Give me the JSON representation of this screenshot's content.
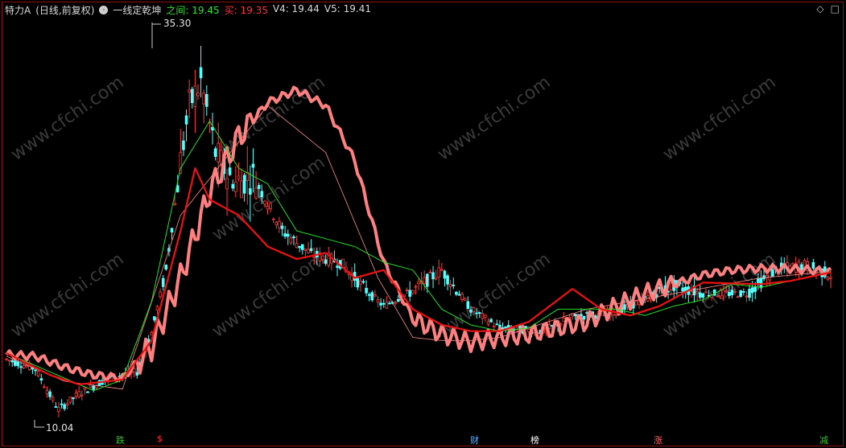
{
  "header": {
    "stock": "特力A",
    "mode": "(日线,前复权)",
    "indicator": "一线定乾坤",
    "items": [
      {
        "label": "之间:",
        "value": "19.45",
        "color": "#33dd33"
      },
      {
        "label": "买:",
        "value": "19.35",
        "color": "#ff3333"
      },
      {
        "label": "V4:",
        "value": "19.44",
        "color": "#d8d8d8"
      },
      {
        "label": "V5:",
        "value": "19.41",
        "color": "#d8d8d8"
      }
    ],
    "corner_icons": [
      "diamond-icon",
      "square-icon"
    ]
  },
  "annotations": {
    "high": "35.30",
    "low": "10.04"
  },
  "badges": [
    {
      "text": "跌",
      "color": "#22cc22"
    },
    {
      "text": "$",
      "color": "#ff2a2a"
    },
    {
      "text": "财",
      "color": "#5ab0ff"
    },
    {
      "text": "榜",
      "color": "#ffffff"
    },
    {
      "text": "涨",
      "color": "#ff6666"
    },
    {
      "text": "减",
      "color": "#22cc22"
    }
  ],
  "watermark": "www.cfchi.com",
  "chart_data": {
    "type": "candlestick",
    "ylim": [
      10.04,
      35.3
    ],
    "grid": false,
    "colors": {
      "up": "#ff3a3a",
      "down": "#54ffff",
      "ma_green": "#22dd22",
      "ma_red": "#ee1111",
      "band": "#ff8080",
      "thin": "#ff8c8c"
    },
    "series_keypoints": {
      "ma_green": [
        [
          0,
          14.2
        ],
        [
          20,
          12.6
        ],
        [
          30,
          11.8
        ],
        [
          40,
          12.5
        ],
        [
          50,
          17.5
        ],
        [
          60,
          26
        ],
        [
          70,
          29
        ],
        [
          80,
          26
        ],
        [
          90,
          25
        ],
        [
          100,
          22
        ],
        [
          110,
          21.5
        ],
        [
          120,
          21
        ],
        [
          130,
          20
        ],
        [
          140,
          19.5
        ],
        [
          150,
          17
        ],
        [
          160,
          16
        ],
        [
          170,
          15.6
        ],
        [
          180,
          15.8
        ],
        [
          190,
          17
        ],
        [
          200,
          17
        ],
        [
          210,
          17
        ],
        [
          220,
          16.6
        ],
        [
          230,
          17.2
        ],
        [
          240,
          17.6
        ],
        [
          250,
          18.6
        ],
        [
          260,
          18.4
        ],
        [
          270,
          18.8
        ],
        [
          284,
          19.4
        ]
      ],
      "ma_red": [
        [
          0,
          14.2
        ],
        [
          15,
          12.8
        ],
        [
          25,
          12.2
        ],
        [
          40,
          12.5
        ],
        [
          50,
          15
        ],
        [
          60,
          22
        ],
        [
          65,
          26
        ],
        [
          70,
          24
        ],
        [
          80,
          23
        ],
        [
          90,
          21
        ],
        [
          100,
          20.2
        ],
        [
          110,
          20.6
        ],
        [
          120,
          19
        ],
        [
          130,
          19.5
        ],
        [
          140,
          17
        ],
        [
          150,
          16
        ],
        [
          160,
          15.6
        ],
        [
          170,
          15.6
        ],
        [
          180,
          16.2
        ],
        [
          195,
          18.3
        ],
        [
          205,
          17
        ],
        [
          215,
          16.6
        ],
        [
          225,
          17.2
        ],
        [
          240,
          18.7
        ],
        [
          260,
          18.6
        ],
        [
          270,
          18.8
        ],
        [
          284,
          19.35
        ]
      ],
      "band": [
        [
          0,
          14.1
        ],
        [
          10,
          14
        ],
        [
          20,
          13.3
        ],
        [
          30,
          12.8
        ],
        [
          40,
          12.6
        ],
        [
          50,
          14.6
        ],
        [
          60,
          19
        ],
        [
          70,
          24.5
        ],
        [
          80,
          28
        ],
        [
          90,
          30.2
        ],
        [
          100,
          31
        ],
        [
          110,
          30
        ],
        [
          120,
          26.5
        ],
        [
          130,
          20
        ],
        [
          140,
          16.4
        ],
        [
          150,
          15.4
        ],
        [
          160,
          14.9
        ],
        [
          170,
          15.2
        ],
        [
          180,
          15.4
        ],
        [
          190,
          15.8
        ],
        [
          200,
          16.2
        ],
        [
          210,
          17.2
        ],
        [
          220,
          18
        ],
        [
          230,
          18.6
        ],
        [
          240,
          19.2
        ],
        [
          250,
          19.5
        ],
        [
          260,
          19.6
        ],
        [
          270,
          19.6
        ],
        [
          284,
          19.4
        ]
      ],
      "thin": [
        [
          0,
          14
        ],
        [
          20,
          12.4
        ],
        [
          40,
          11.9
        ],
        [
          60,
          23
        ],
        [
          90,
          30
        ],
        [
          110,
          27
        ],
        [
          128,
          19
        ],
        [
          140,
          15.2
        ],
        [
          150,
          15
        ],
        [
          160,
          15
        ],
        [
          170,
          15.2
        ],
        [
          200,
          17
        ],
        [
          230,
          18
        ],
        [
          260,
          19
        ],
        [
          284,
          19.4
        ]
      ]
    }
  }
}
